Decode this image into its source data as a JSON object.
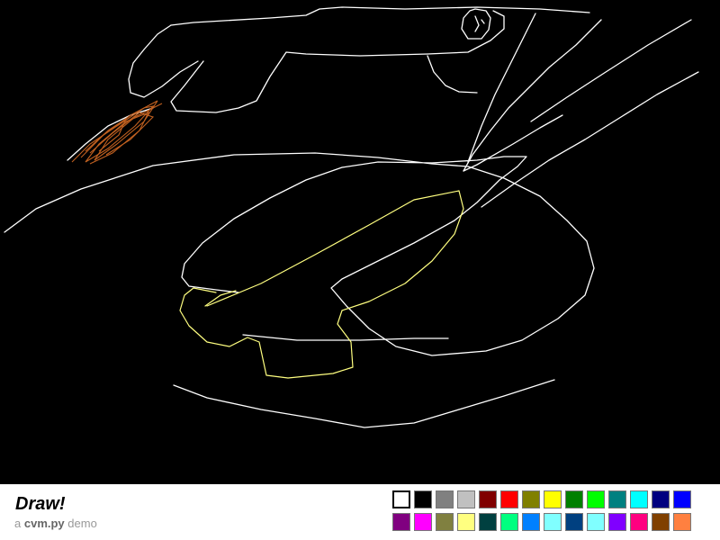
{
  "app": {
    "title": "Draw!",
    "subtitle_prefix": "a",
    "subtitle_brand": "cvm.py",
    "subtitle_suffix": "demo"
  },
  "palette": {
    "selected_index": 0,
    "colors": [
      "#ffffff",
      "#000000",
      "#808080",
      "#c0c0c0",
      "#800000",
      "#ff0000",
      "#808000",
      "#ffff00",
      "#008000",
      "#00ff00",
      "#008080",
      "#00ffff",
      "#000080",
      "#0000ff",
      "#800080",
      "#ff00ff",
      "#808040",
      "#ffff80",
      "#004040",
      "#00ff80",
      "#0080ff",
      "#80ffff",
      "#004080",
      "#80ffff",
      "#8000ff",
      "#ff0080",
      "#804000",
      "#ff8040"
    ]
  },
  "canvas": {
    "background": "#000000",
    "stroke_colors": {
      "white": "#ffffff",
      "yellow": "#ffff80",
      "orange": "#c06020"
    }
  }
}
